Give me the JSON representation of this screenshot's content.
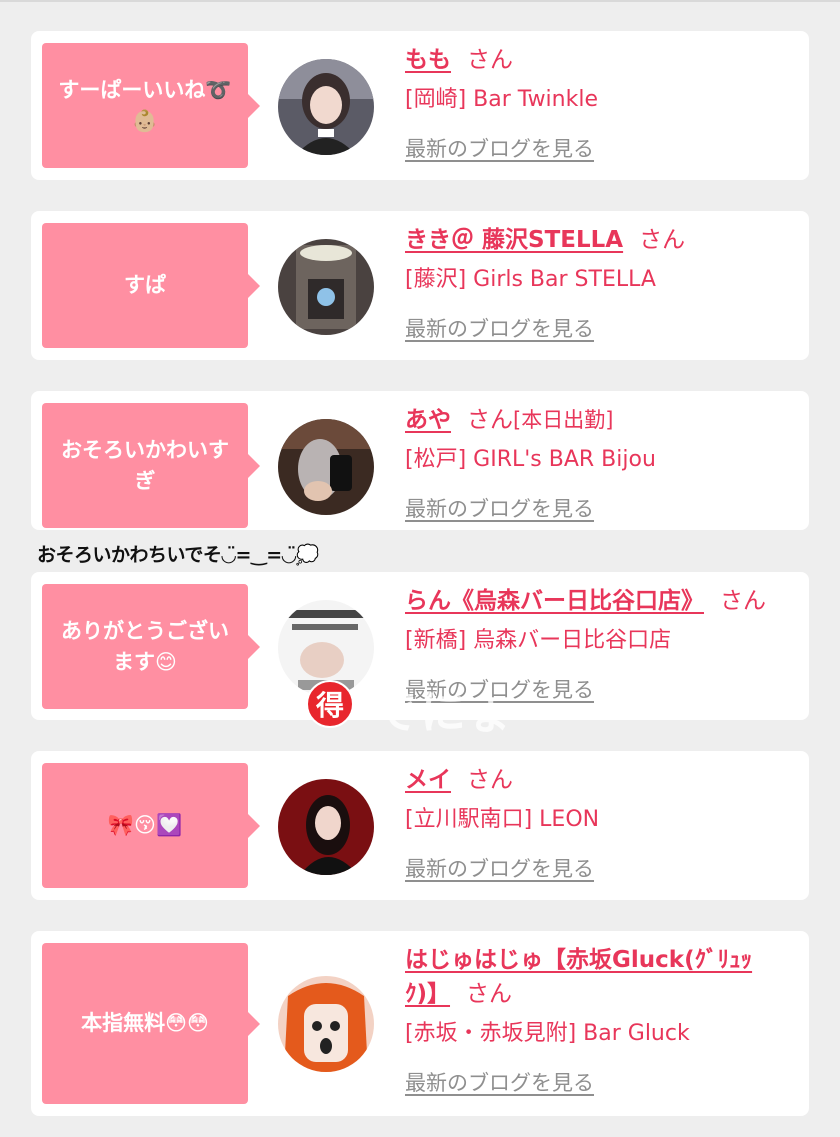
{
  "posts": [
    {
      "comment_text": "すーぱーいいね➰👶🏼",
      "name": "もも",
      "san": "さん",
      "status": "",
      "shop": "[岡崎] Bar Twinkle",
      "blog_link": "最新のブログを見る"
    },
    {
      "comment_text": "すぱ",
      "name": "きき＠ 藤沢STELLA",
      "san": "さん",
      "status": "",
      "shop": "[藤沢] Girls Bar STELLA",
      "blog_link": "最新のブログを見る"
    },
    {
      "comment_text": "おそろいかわいすぎ",
      "name": "あや",
      "san": "さん",
      "status": "[本日出勤]",
      "shop": "[松戸] GIRL's BAR Bijou",
      "blog_link": "最新のブログを見る"
    },
    {
      "comment_text": "ありがとうございます😊",
      "name": "らん《烏森バー日比谷口店》",
      "san": "さん",
      "status": "",
      "shop": "[新橋] 烏森バー日比谷口店",
      "blog_link": "最新のブログを見る"
    },
    {
      "comment_text": "🎀😚💟",
      "name": "メイ",
      "san": "さん",
      "status": "",
      "shop": "[立川駅南口] LEON",
      "blog_link": "最新のブログを見る"
    },
    {
      "comment_text": "本指無料😳😳",
      "name": "はじゅはじゅ【赤坂Gluck(ｸﾞﾘｭｯｸ)】",
      "san": "さん",
      "status": "",
      "shop": "[赤坂・赤坂見附] Bar Gluck",
      "blog_link": "最新のブログを見る"
    }
  ],
  "overlay": {
    "comment_caption": "おそろいかわちいでそ◡̈=‿=◡̈💭",
    "toku_badge": "得",
    "watermark": "でにょ"
  },
  "colors": {
    "accent": "#e8365a",
    "bubble": "#ff8fa2",
    "link_gray": "#8f8f8f"
  }
}
